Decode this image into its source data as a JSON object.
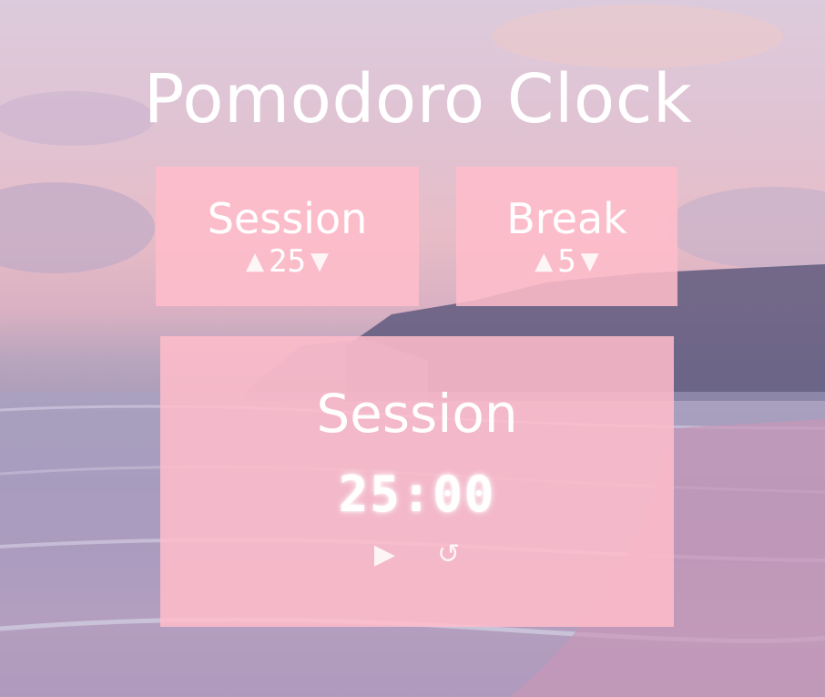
{
  "app": {
    "title": "Pomodoro Clock"
  },
  "session_length": {
    "label": "Session",
    "value": "25",
    "increment_icon": "triangle-up-icon",
    "decrement_icon": "triangle-down-icon"
  },
  "break_length": {
    "label": "Break",
    "value": "5",
    "increment_icon": "triangle-up-icon",
    "decrement_icon": "triangle-down-icon"
  },
  "timer": {
    "label": "Session",
    "time": "25:00",
    "play_icon": "play-icon",
    "reset_icon": "reset-icon"
  },
  "colors": {
    "panel": "#ffbdcb",
    "text": "#ffffff"
  }
}
